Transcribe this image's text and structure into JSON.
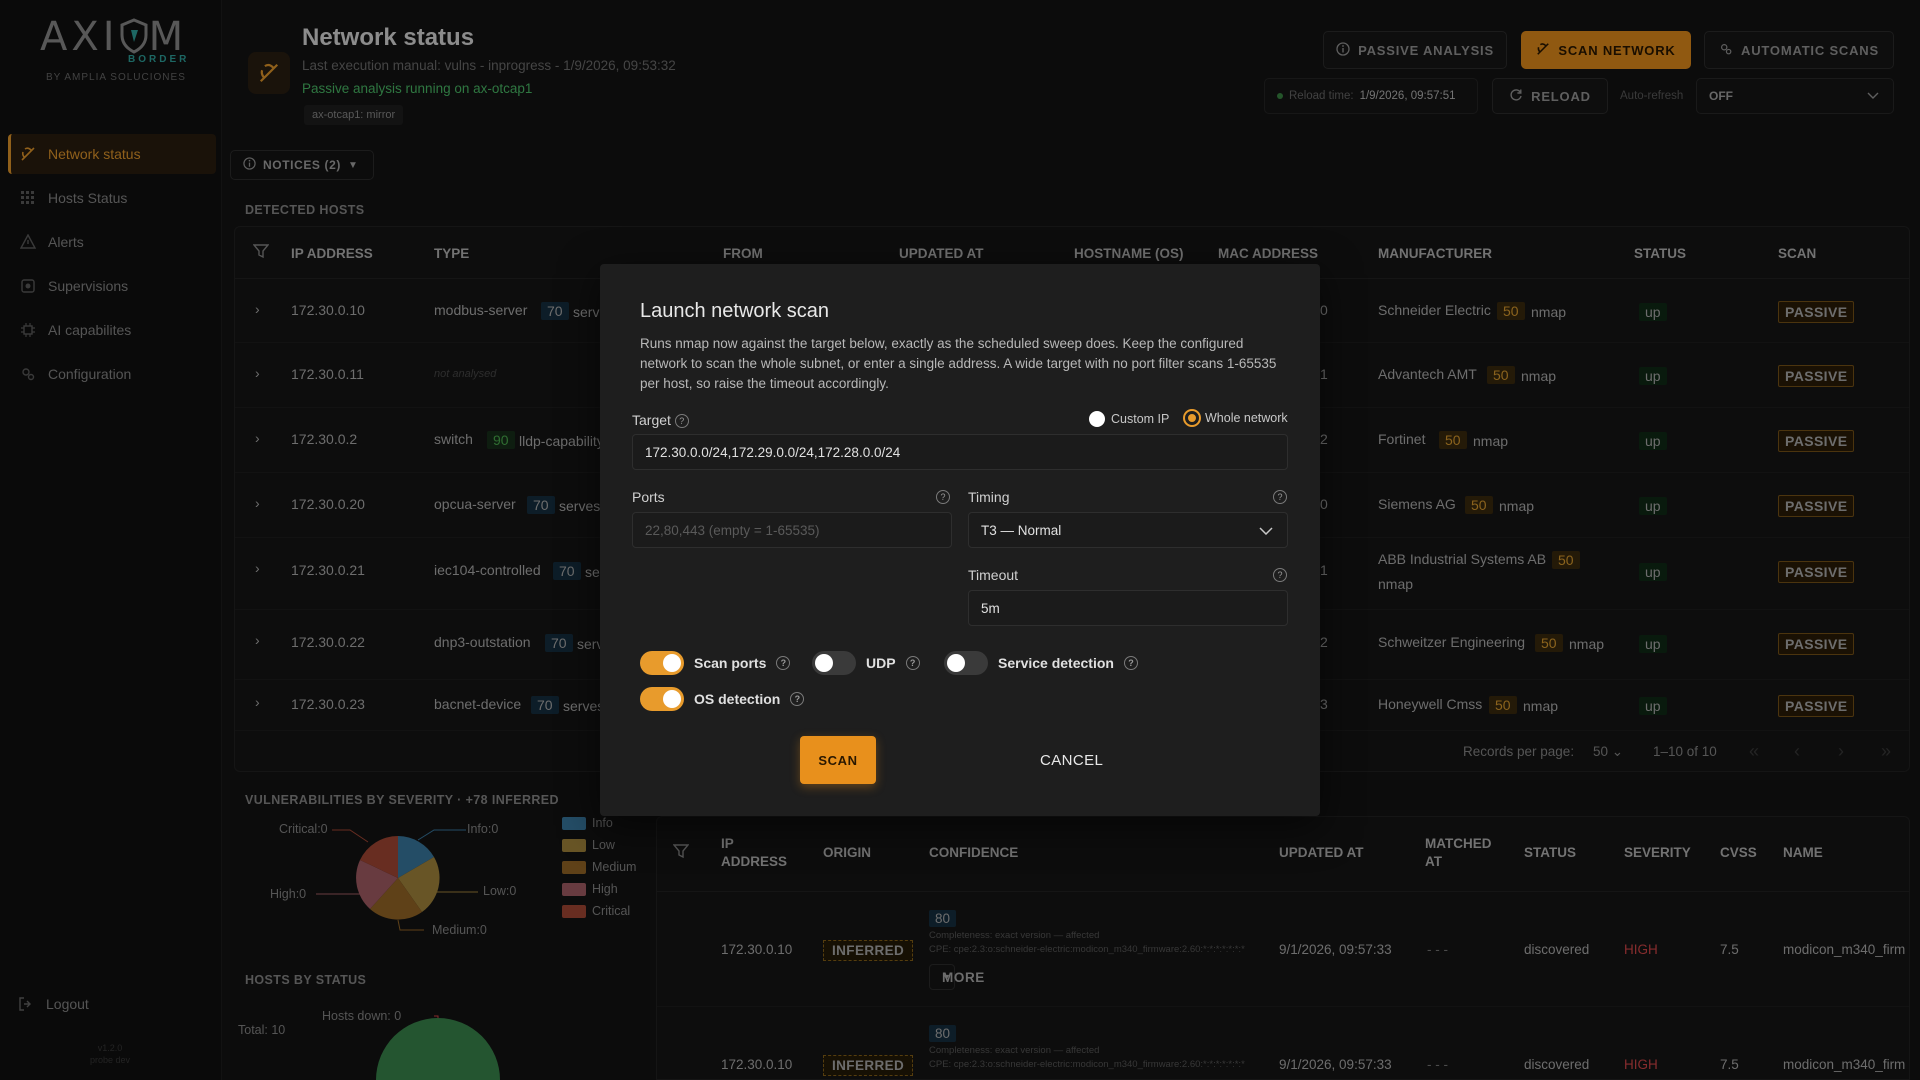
{
  "app": {
    "logo_word": "AXI  M",
    "logo_border": "BORDER",
    "logo_sub": "BY AMPLIA SOLUCIONES",
    "version_line1": "v1.2.0",
    "version_line2": "probe dev"
  },
  "sidebar": {
    "items": [
      {
        "label": "Network status",
        "icon": "network-status-icon",
        "active": true
      },
      {
        "label": "Hosts Status",
        "icon": "grid-icon"
      },
      {
        "label": "Alerts",
        "icon": "warning-icon"
      },
      {
        "label": "Supervisions",
        "icon": "supervision-icon"
      },
      {
        "label": "AI capabilites",
        "icon": "ai-chip-icon"
      },
      {
        "label": "Configuration",
        "icon": "gear-icon"
      }
    ],
    "logout": "Logout"
  },
  "header": {
    "title": "Network status",
    "last_execution": "Last execution manual: vulns - inprogress - 1/9/2026, 09:53:32",
    "passive_running": "Passive analysis running on ax-otcap1",
    "interface_chip": "ax-otcap1: mirror",
    "btn_passive": "PASSIVE ANALYSIS",
    "btn_scan": "SCAN NETWORK",
    "btn_auto": "AUTOMATIC SCANS",
    "reload_time_label": "Reload time:",
    "reload_time_value": "1/9/2026, 09:57:51",
    "btn_reload": "RELOAD",
    "auto_refresh_label": "Auto-refresh",
    "auto_refresh_value": "OFF"
  },
  "notices": "NOTICES (2)",
  "hosts": {
    "section_title": "DETECTED HOSTS",
    "columns": [
      "IP ADDRESS",
      "TYPE",
      "FROM",
      "UPDATED AT",
      "HOSTNAME (OS)",
      "MAC ADDRESS",
      "MANUFACTURER",
      "STATUS",
      "SCAN"
    ],
    "rows": [
      {
        "ip": "172.30.0.10",
        "type": "modbus-server",
        "conf": "70",
        "src": "serve",
        "mac_tail": "0",
        "manufacturer": "Schneider Electric",
        "mconf": "50",
        "msrc": "nmap",
        "status": "up",
        "scan": "PASSIVE"
      },
      {
        "ip": "172.30.0.11",
        "type": "not analysed",
        "conf": "",
        "src": "",
        "mac_tail": "1",
        "manufacturer": "Advantech AMT",
        "mconf": "50",
        "msrc": "nmap",
        "status": "up",
        "scan": "PASSIVE"
      },
      {
        "ip": "172.30.0.2",
        "type": "switch",
        "conf": "90",
        "src": "lldp-capability",
        "mac_tail": "2",
        "manufacturer": "Fortinet",
        "mconf": "50",
        "msrc": "nmap",
        "status": "up",
        "scan": "PASSIVE"
      },
      {
        "ip": "172.30.0.20",
        "type": "opcua-server",
        "conf": "70",
        "src": "serves-p",
        "mac_tail": "0",
        "manufacturer": "Siemens AG",
        "mconf": "50",
        "msrc": "nmap",
        "status": "up",
        "scan": "PASSIVE"
      },
      {
        "ip": "172.30.0.21",
        "type": "iec104-controlled",
        "conf": "70",
        "src": "se",
        "mac_tail": "1",
        "manufacturer": "ABB Industrial Systems AB",
        "mconf": "50",
        "msrc": "nmap",
        "status": "up",
        "scan": "PASSIVE"
      },
      {
        "ip": "172.30.0.22",
        "type": "dnp3-outstation",
        "conf": "70",
        "src": "serv",
        "mac_tail": "2",
        "manufacturer": "Schweitzer Engineering",
        "mconf": "50",
        "msrc": "nmap",
        "status": "up",
        "scan": "PASSIVE"
      },
      {
        "ip": "172.30.0.23",
        "type": "bacnet-device",
        "conf": "70",
        "src": "serves",
        "mac_tail": "3",
        "manufacturer": "Honeywell Cmss",
        "mconf": "50",
        "msrc": "nmap",
        "status": "up",
        "scan": "PASSIVE"
      }
    ],
    "records_per_page_label": "Records per page:",
    "records_per_page": "50",
    "range": "1–10 of 10"
  },
  "vulns": {
    "section_title": "VULNERABILITIES BY SEVERITY · +78 INFERRED",
    "pie_labels": {
      "critical": "Critical:0",
      "info": "Info:0",
      "low": "Low:0",
      "medium": "Medium:0",
      "high": "High:0"
    },
    "legend": [
      {
        "name": "Info",
        "color": "#3a7ca5"
      },
      {
        "name": "Low",
        "color": "#a88a3e"
      },
      {
        "name": "Medium",
        "color": "#9a6a28"
      },
      {
        "name": "High",
        "color": "#a86068"
      },
      {
        "name": "Critical",
        "color": "#a84a36"
      }
    ],
    "columns": [
      "IP ADDRESS",
      "ORIGIN",
      "CONFIDENCE",
      "UPDATED AT",
      "MATCHED AT",
      "STATUS",
      "SEVERITY",
      "CVSS",
      "NAME"
    ],
    "rows": [
      {
        "ip": "172.30.0.10",
        "origin": "INFERRED",
        "conf": "80",
        "line1": "Completeness: exact version — affected",
        "line2": "CPE: cpe:2.3:o:schneider-electric:modicon_m340_firmware:2.60:*:*:*:*:*:*:*",
        "updated": "9/1/2026, 09:57:33",
        "matched": "- - -",
        "status": "discovered",
        "severity": "HIGH",
        "cvss": "7.5",
        "name": "modicon_m340_firm",
        "more": "MORE"
      },
      {
        "ip": "172.30.0.10",
        "origin": "INFERRED",
        "conf": "80",
        "line1": "Completeness: exact version — affected",
        "line2": "CPE: cpe:2.3:o:schneider-electric:modicon_m340_firmware:2.60:*:*:*:*:*:*:*",
        "updated": "9/1/2026, 09:57:33",
        "matched": "- - -",
        "status": "discovered",
        "severity": "HIGH",
        "cvss": "7.5",
        "name": "modicon_m340_firm"
      }
    ]
  },
  "host_status": {
    "section_title": "HOSTS BY STATUS",
    "total": "Total: 10",
    "down_label": "Hosts down: 0"
  },
  "modal": {
    "title": "Launch network scan",
    "description": "Runs nmap now against the target below, exactly as the scheduled sweep does. Keep the configured network to scan the whole subnet, or enter a single address. A wide target with no port filter scans 1-65535 per host, so raise the timeout accordingly.",
    "target_label": "Target",
    "radio_custom": "Custom IP",
    "radio_whole": "Whole network",
    "target_value": "172.30.0.0/24,172.29.0.0/24,172.28.0.0/24",
    "ports_label": "Ports",
    "ports_placeholder": "22,80,443 (empty = 1-65535)",
    "timing_label": "Timing",
    "timing_value": "T3 — Normal",
    "timeout_label": "Timeout",
    "timeout_value": "5m",
    "toggle_scan_ports": "Scan ports",
    "toggle_udp": "UDP",
    "toggle_service": "Service detection",
    "toggle_os": "OS detection",
    "btn_scan": "SCAN",
    "btn_cancel": "CANCEL"
  },
  "colors": {
    "accent": "#e89b2c",
    "up": "#3ea85a",
    "high": "#d8484a"
  }
}
